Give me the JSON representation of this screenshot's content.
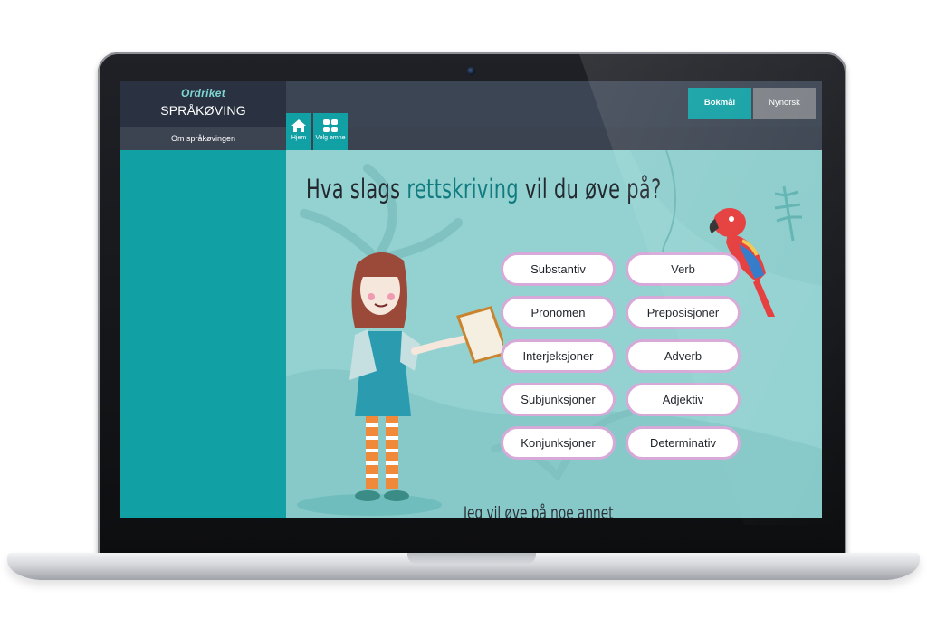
{
  "brand": {
    "logo": "Ordriket",
    "title": "SPRÅKØVING"
  },
  "sidebar": {
    "about_link": "Om språkøvingen"
  },
  "languages": {
    "bokmal": "Bokmål",
    "nynorsk": "Nynorsk",
    "selected": "Bokmål"
  },
  "nav": {
    "home": {
      "label": "Hjem",
      "icon": "home-icon"
    },
    "topic": {
      "label": "Velg emne",
      "icon": "grid-icon"
    }
  },
  "main": {
    "heading_pre": "Hva slags",
    "heading_highlight": "rettskriving",
    "heading_post": "vil du øve på?",
    "options": [
      "Substantiv",
      "Verb",
      "Pronomen",
      "Preposisjoner",
      "Interjeksjoner",
      "Adverb",
      "Subjunksjoner",
      "Adjektiv",
      "Konjunksjoner",
      "Determinativ"
    ],
    "subtitle": "Jeg vil øve på noe annet"
  },
  "colors": {
    "accent": "#11a0a4",
    "header_dark": "#2a3241",
    "header": "#3c4553",
    "background": "#93d2d1",
    "button_border": "#d6a9d8",
    "nynorsk_button": "#7c8086"
  }
}
